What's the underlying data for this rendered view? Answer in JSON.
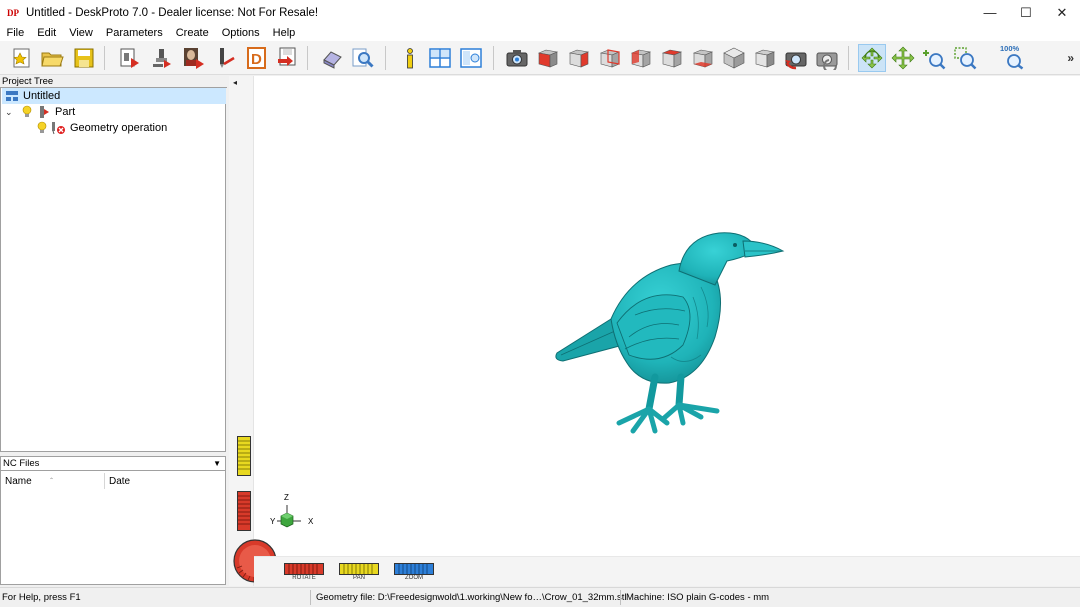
{
  "window": {
    "app_icon_text": "DP",
    "title": "Untitled - DeskProto 7.0 - Dealer license: Not For Resale!",
    "minimize": "—",
    "maximize": "☐",
    "close": "✕"
  },
  "menu": [
    "File",
    "Edit",
    "View",
    "Parameters",
    "Create",
    "Options",
    "Help"
  ],
  "toolbar": {
    "zoom_percent_label": "100%",
    "more": "»",
    "buttons": [
      "new-project-icon",
      "open-folder-icon",
      "save-icon",
      "part-geometry-icon",
      "machine-icon",
      "bitmap-relief-icon",
      "drill-icon",
      "d-template-icon",
      "export-icon",
      "eraser-icon",
      "search-icon",
      "info-icon",
      "multi-view-icon",
      "view-toggle-icon",
      "camera-icon",
      "view-front-cube-icon",
      "view-right-cube-icon",
      "view-back-cube-icon",
      "view-left-cube-icon",
      "view-top-cube-icon",
      "view-bottom-cube-icon",
      "view-iso-cube-icon",
      "view-iso2-cube-icon",
      "refresh-camera-icon",
      "reset-camera-icon",
      "rotate-icon",
      "pan-icon",
      "zoom-icon",
      "zoom-window-icon",
      "zoom-fit-icon"
    ],
    "active": "rotate-icon"
  },
  "project_tree": {
    "header": "Project Tree",
    "items": [
      {
        "label": "Untitled",
        "level": 0,
        "selected": true
      },
      {
        "label": "Part",
        "level": 1,
        "expanded": true
      },
      {
        "label": "Geometry operation",
        "level": 2
      }
    ]
  },
  "nc_files": {
    "header": "NC Files",
    "columns": [
      "Name",
      "Date"
    ]
  },
  "view": {
    "collapse_arrow": "◂",
    "model_color": "#1fb3b8",
    "axis": {
      "x": "X",
      "y": "Y",
      "z": "Z"
    },
    "sliders": [
      {
        "name": "rotate",
        "label": "ROTATE",
        "color": "#d83a2a"
      },
      {
        "name": "pan",
        "label": "PAN",
        "color": "#e8d820"
      },
      {
        "name": "zoom",
        "label": "ZOOM",
        "color": "#2d7fd8"
      }
    ],
    "vertical_sliders": [
      {
        "name": "pan",
        "color": "#e8d820"
      },
      {
        "name": "rotate",
        "color": "#d83a2a"
      }
    ]
  },
  "status": {
    "help": "For Help, press F1",
    "geometry_file": "Geometry file: D:\\Freedesignwold\\1.working\\New fo…\\Crow_01_32mm.stl",
    "machine": "Machine: ISO plain G-codes - mm"
  }
}
